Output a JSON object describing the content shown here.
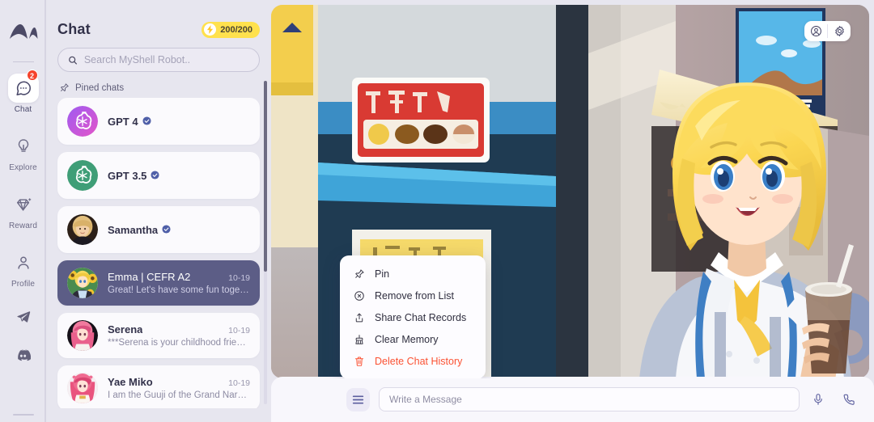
{
  "brand": {
    "logo_name": "myshell-logo"
  },
  "rail": {
    "items": [
      {
        "label": "Chat",
        "icon": "chat-bubble-icon",
        "badge": "2",
        "active": true
      },
      {
        "label": "Explore",
        "icon": "lightbulb-icon",
        "badge": "",
        "active": false
      },
      {
        "label": "Reward",
        "icon": "diamond-icon",
        "badge": "",
        "active": false
      },
      {
        "label": "Profile",
        "icon": "person-icon",
        "badge": "",
        "active": false
      }
    ],
    "social": [
      {
        "name": "telegram-icon"
      },
      {
        "name": "discord-icon"
      }
    ]
  },
  "panel": {
    "title": "Chat",
    "energy": {
      "value": "200/200",
      "icon": "lightning-bolt-icon",
      "color": "#ffe14d"
    },
    "search": {
      "placeholder": "Search MyShell Robot..",
      "value": "",
      "icon": "search-icon"
    },
    "pinned_label": "Pined chats",
    "pinned": [
      {
        "name": "GPT 4",
        "verified": true,
        "avatar": "openai-purple"
      },
      {
        "name": "GPT 3.5",
        "verified": true,
        "avatar": "openai-green"
      },
      {
        "name": "Samantha",
        "verified": true,
        "avatar": "samantha-photo"
      }
    ],
    "chats": [
      {
        "name": "Emma | CEFR A2",
        "date": "10-19",
        "preview": "Great! Let's have some fun togeth...",
        "avatar": "emma-anime",
        "selected": true
      },
      {
        "name": "Serena",
        "date": "10-19",
        "preview": "***Serena is your childhood friend ...",
        "avatar": "serena-anime",
        "selected": false
      },
      {
        "name": "Yae Miko",
        "date": "10-19",
        "preview": "I am the Guuji of the Grand Naruk...",
        "avatar": "yaemiko-anime",
        "selected": false
      }
    ]
  },
  "stage": {
    "actions": [
      {
        "name": "profile-circle-icon"
      },
      {
        "name": "gear-icon"
      }
    ]
  },
  "context_menu": {
    "items": [
      {
        "label": "Pin",
        "icon": "pin-icon",
        "danger": false
      },
      {
        "label": "Remove from List",
        "icon": "remove-circle-icon",
        "danger": false
      },
      {
        "label": "Share Chat Records",
        "icon": "share-upload-icon",
        "danger": false
      },
      {
        "label": "Clear Memory",
        "icon": "broom-icon",
        "danger": false
      },
      {
        "label": "Delete Chat History",
        "icon": "trash-icon",
        "danger": true
      }
    ],
    "danger_color": "#fb5233"
  },
  "composer": {
    "menu_icon": "hamburger-menu-icon",
    "input": {
      "placeholder": "Write a Message",
      "value": ""
    },
    "mic_icon": "microphone-icon",
    "call_icon": "phone-call-icon"
  }
}
